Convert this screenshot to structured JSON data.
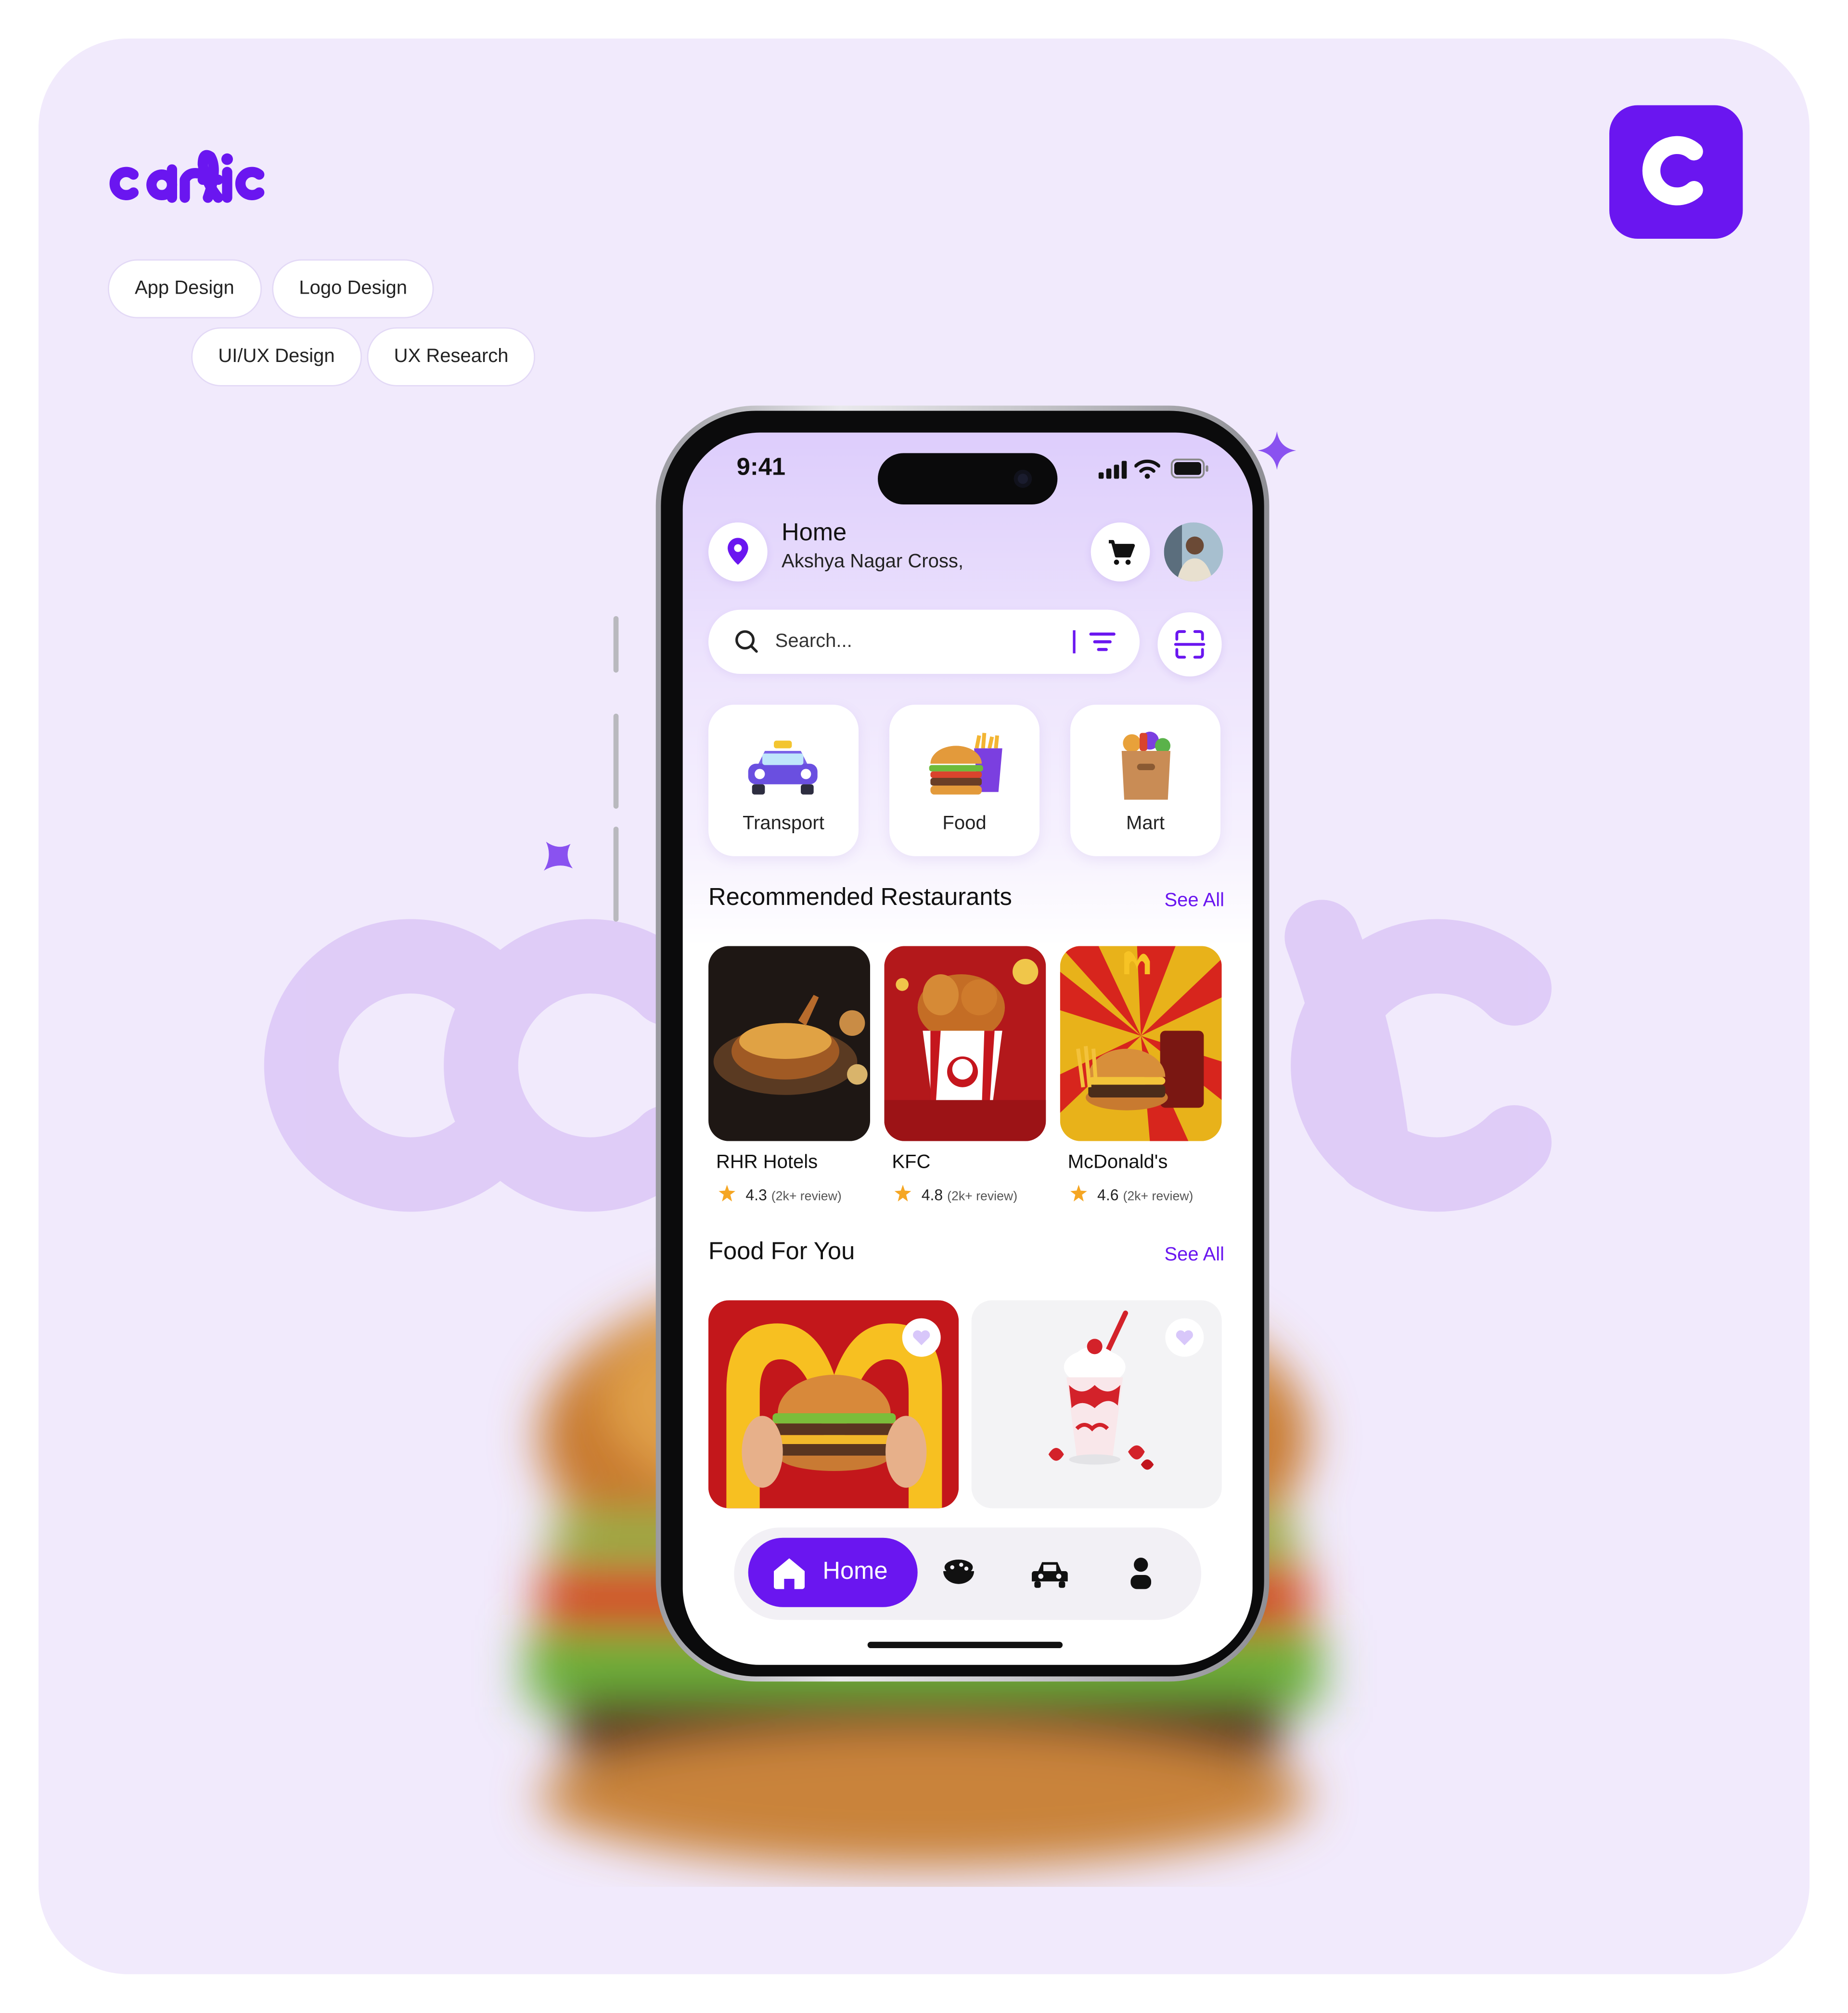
{
  "brand": {
    "logo_text": "carific",
    "badge_letter": "c",
    "accent_color": "#6a16f0",
    "background_color": "#f1eafc"
  },
  "tags": [
    "App Design",
    "Logo Design",
    "UI/UX Design",
    "UX Research"
  ],
  "phone": {
    "status_bar": {
      "time": "9:41",
      "icons": [
        "signal-icon",
        "wifi-icon",
        "battery-icon"
      ]
    },
    "location": {
      "title": "Home",
      "address": "Akshya Nagar Cross,"
    },
    "search": {
      "placeholder": "Search..."
    },
    "categories": [
      {
        "label": "Transport",
        "icon": "taxi-icon"
      },
      {
        "label": "Food",
        "icon": "burger-fries-icon"
      },
      {
        "label": "Mart",
        "icon": "grocery-bag-icon"
      }
    ],
    "recommended": {
      "title": "Recommended Restaurants",
      "see_all": "See All",
      "items": [
        {
          "name": "RHR Hotels",
          "rating": "4.3",
          "reviews": "(2k+ review)"
        },
        {
          "name": "KFC",
          "rating": "4.8",
          "reviews": "(2k+ review)"
        },
        {
          "name": "McDonald's",
          "rating": "4.6",
          "reviews": "(2k+ review)"
        }
      ]
    },
    "food_for_you": {
      "title": "Food For You",
      "see_all": "See All"
    },
    "bottom_nav": {
      "active": "Home",
      "items": [
        "home-icon",
        "food-bowl-icon",
        "car-icon",
        "profile-icon"
      ]
    }
  }
}
